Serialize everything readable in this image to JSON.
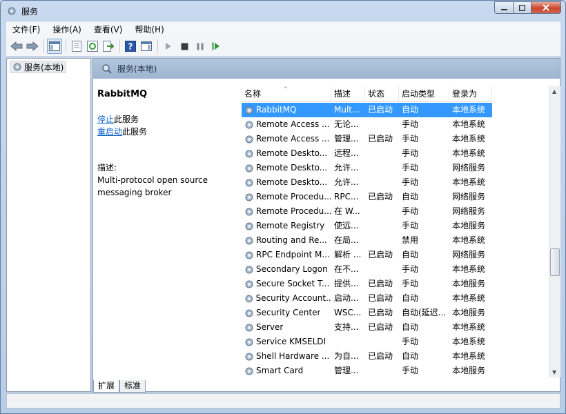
{
  "window": {
    "title": "服务"
  },
  "menu": [
    "文件(F)",
    "操作(A)",
    "查看(V)",
    "帮助(H)"
  ],
  "tree": {
    "root": "服务(本地)"
  },
  "panel": {
    "header": "服务(本地)"
  },
  "detail": {
    "service_name": "RabbitMQ",
    "stop_link": "停止",
    "stop_suffix": "此服务",
    "restart_link": "重启动",
    "restart_suffix": "此服务",
    "desc_label": "描述:",
    "desc_line1": "Multi-protocol open source",
    "desc_line2": "messaging broker"
  },
  "columns": [
    "名称",
    "描述",
    "状态",
    "启动类型",
    "登录为"
  ],
  "rows": [
    {
      "name": "RabbitMQ",
      "desc": "Mult...",
      "status": "已启动",
      "start": "自动",
      "logon": "本地系统"
    },
    {
      "name": "Remote Access ...",
      "desc": "无论...",
      "status": "",
      "start": "手动",
      "logon": "本地系统"
    },
    {
      "name": "Remote Access ...",
      "desc": "管理...",
      "status": "已启动",
      "start": "手动",
      "logon": "本地系统"
    },
    {
      "name": "Remote Deskto...",
      "desc": "远程...",
      "status": "",
      "start": "手动",
      "logon": "本地系统"
    },
    {
      "name": "Remote Deskto...",
      "desc": "允许...",
      "status": "",
      "start": "手动",
      "logon": "网络服务"
    },
    {
      "name": "Remote Deskto...",
      "desc": "允许...",
      "status": "",
      "start": "手动",
      "logon": "本地系统"
    },
    {
      "name": "Remote Procedu...",
      "desc": "RPC...",
      "status": "已启动",
      "start": "自动",
      "logon": "网络服务"
    },
    {
      "name": "Remote Procedu...",
      "desc": "在 W...",
      "status": "",
      "start": "手动",
      "logon": "网络服务"
    },
    {
      "name": "Remote Registry",
      "desc": "使远...",
      "status": "",
      "start": "手动",
      "logon": "本地服务"
    },
    {
      "name": "Routing and Re...",
      "desc": "在局...",
      "status": "",
      "start": "禁用",
      "logon": "本地系统"
    },
    {
      "name": "RPC Endpoint M...",
      "desc": "解析 ...",
      "status": "已启动",
      "start": "自动",
      "logon": "网络服务"
    },
    {
      "name": "Secondary Logon",
      "desc": "在不...",
      "status": "",
      "start": "手动",
      "logon": "本地系统"
    },
    {
      "name": "Secure Socket T...",
      "desc": "提供...",
      "status": "已启动",
      "start": "手动",
      "logon": "本地服务"
    },
    {
      "name": "Security Account...",
      "desc": "启动...",
      "status": "已启动",
      "start": "自动",
      "logon": "本地系统"
    },
    {
      "name": "Security Center",
      "desc": "WSC...",
      "status": "已启动",
      "start": "自动(延迟...",
      "logon": "本地服务"
    },
    {
      "name": "Server",
      "desc": "支持...",
      "status": "已启动",
      "start": "自动",
      "logon": "本地系统"
    },
    {
      "name": "Service KMSELDI",
      "desc": "",
      "status": "",
      "start": "手动",
      "logon": "本地系统"
    },
    {
      "name": "Shell Hardware ...",
      "desc": "为自...",
      "status": "已启动",
      "start": "自动",
      "logon": "本地系统"
    },
    {
      "name": "Smart Card",
      "desc": "管理...",
      "status": "",
      "start": "手动",
      "logon": "本地服务"
    }
  ],
  "tabs": [
    "扩展",
    "标准"
  ],
  "colors": {
    "selection": "#3399ff",
    "link": "#0e63c6",
    "header": "#9cb5d1"
  }
}
